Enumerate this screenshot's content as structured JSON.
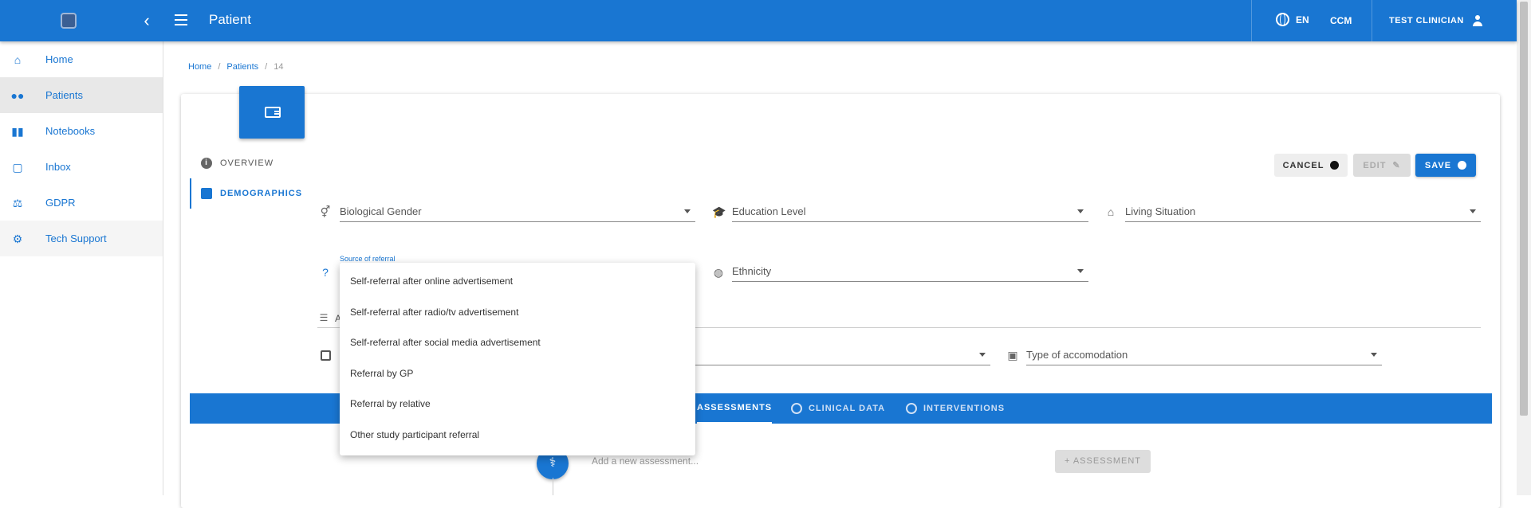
{
  "header": {
    "title": "Patient",
    "language": "EN",
    "org": "CCM",
    "user": "TEST CLINICIAN",
    "collapse_glyph": "‹"
  },
  "sidebar": {
    "items": [
      {
        "label": "Home",
        "icon": "home-icon"
      },
      {
        "label": "Patients",
        "icon": "patients-icon"
      },
      {
        "label": "Notebooks",
        "icon": "bar-chart-icon"
      },
      {
        "label": "Inbox",
        "icon": "inbox-icon"
      },
      {
        "label": "GDPR",
        "icon": "gavel-icon"
      },
      {
        "label": "Tech Support",
        "icon": "support-icon"
      }
    ]
  },
  "breadcrumb": {
    "home": "Home",
    "patients": "Patients",
    "current": "14",
    "sep": "/"
  },
  "sections": {
    "overview": "OVERVIEW",
    "demographics": "DEMOGRAPHICS"
  },
  "actions": {
    "cancel": "CANCEL",
    "edit": "EDIT",
    "save": "SAVE"
  },
  "fields": {
    "biological_gender": "Biological Gender",
    "education_level": "Education Level",
    "living_situation": "Living Situation",
    "source_of_referral_label": "Source of referral",
    "ethnicity": "Ethnicity",
    "type_of_accomodation": "Type of accomodation",
    "partial_a": "A"
  },
  "dropdown": {
    "options": [
      "Self-referral after online advertisement",
      "Self-referral after radio/tv advertisement",
      "Self-referral after social media advertisement",
      "Referral by GP",
      "Referral by relative",
      "Other study participant referral"
    ]
  },
  "tabs": {
    "assessments": "ASSESSMENTS",
    "clinical_data": "CLINICAL DATA",
    "interventions": "INTERVENTIONS"
  },
  "assessment": {
    "placeholder": "Add a new assessment...",
    "add_button": "+ ASSESSMENT"
  },
  "colors": {
    "primary": "#1976d2"
  }
}
